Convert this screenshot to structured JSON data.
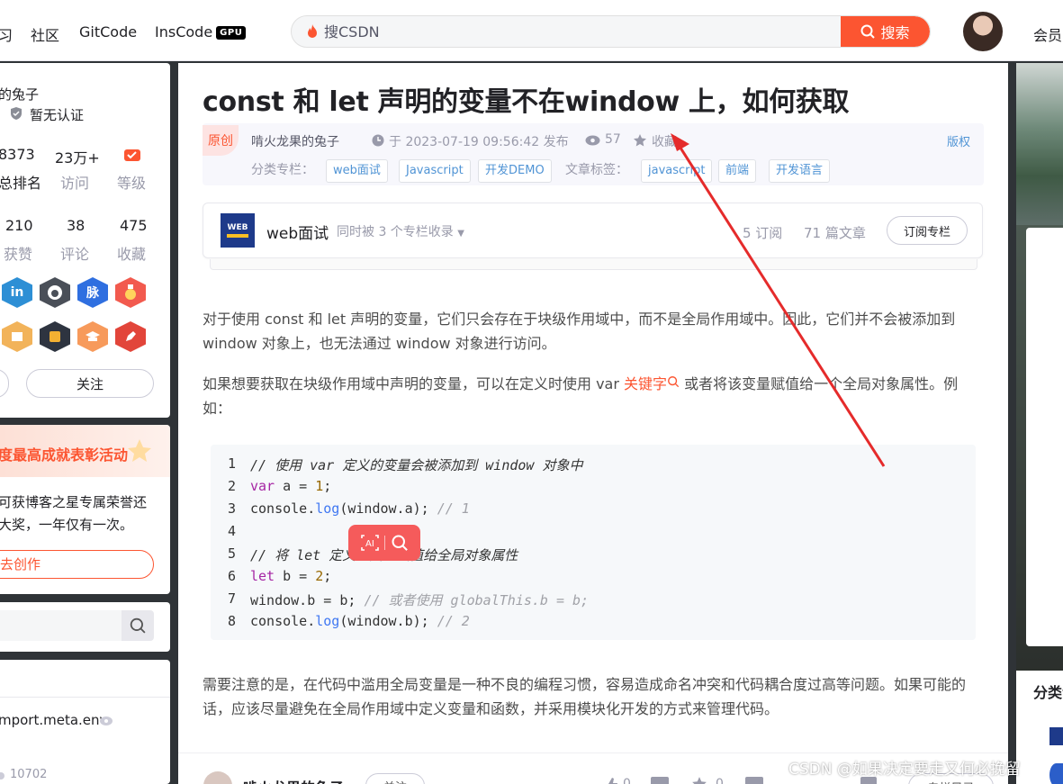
{
  "topnav": {
    "items": [
      "习",
      "社区",
      "GitCode"
    ],
    "inscode": "InsCode",
    "gpu": "GPU",
    "search_placeholder": "搜CSDN",
    "search_button": "搜索",
    "member": "会员"
  },
  "profile": {
    "name": "的兔子",
    "cert": "暂无认证",
    "stats1": [
      {
        "v": "8373",
        "l": "总排名"
      },
      {
        "v": "23万+",
        "l": "访问"
      },
      {
        "v": "",
        "l": "等级"
      }
    ],
    "stats2": [
      {
        "v": "210",
        "l": "获赞"
      },
      {
        "v": "38",
        "l": "评论"
      },
      {
        "v": "475",
        "l": "收藏"
      }
    ],
    "badges1": [
      "in",
      "",
      "脉",
      ""
    ],
    "follow": "关注"
  },
  "promo": {
    "title": "度最高成就表彰活动",
    "line1": "可获博客之星专属荣誉还",
    "line2": "大奖，一年仅有一次。",
    "button": "去创作"
  },
  "left_list": {
    "item": "mport.meta.env",
    "count": "10702"
  },
  "article": {
    "title": "const 和 let 声明的变量不在window 上，如何获取",
    "original": "原创",
    "author": "啃火龙果的兔子",
    "time": "于 2023-07-19 09:56:42 发布",
    "views": "57",
    "collect": "收藏",
    "copyright": "版权",
    "column_label": "分类专栏：",
    "columns": [
      "web面试",
      "Javascript",
      "开发DEMO"
    ],
    "tag_label": "文章标签：",
    "tags": [
      "javascript",
      "前端",
      "开发语言"
    ],
    "colbox": {
      "name": "web面试",
      "also": "同时被 3 个专栏收录",
      "subs": "5 订阅",
      "count": "71 篇文章",
      "subscribe": "订阅专栏",
      "logo": "WEB"
    },
    "p1": "对于使用 const 和 let 声明的变量，它们只会存在于块级作用域中，而不是全局作用域中。因此，它们并不会被添加到 window 对象上，也无法通过 window 对象进行访问。",
    "p2a": "如果想要获取在块级作用域中声明的变量，可以在定义时使用 var ",
    "p2kw": "关键字",
    "p2b": " 或者将该变量赋值给一个全局对象属性。例如：",
    "code": [
      "// 使用 var 定义的变量会被添加到 window 对象中",
      "var a = 1;",
      "console.log(window.a); // 1",
      "",
      "// 将 let 定义的变量赋值给全局对象属性",
      "let b = 2;",
      "window.b = b; // 或者使用 globalThis.b = b;",
      "console.log(window.b); // 2"
    ],
    "p3": "需要注意的是，在代码中滥用全局变量是一种不良的编程习惯，容易造成命名冲突和代码耦合度过高等问题。如果可能的话，应该尽量避免在全局作用域中定义变量和函数，并采用模块化开发的方式来管理代码。",
    "bottom_author": "啃火龙果的兔子",
    "bottom_follow": "关注",
    "bottom_counts": [
      "0",
      "0"
    ],
    "bottom_right": "专栏目录"
  },
  "right": {
    "label": "分类专"
  },
  "watermark": "CSDN @如果决定要走又何必挽留",
  "colors": {
    "accent": "#fc5531",
    "link": "#5094d5",
    "arrow": "#e52b2b"
  }
}
